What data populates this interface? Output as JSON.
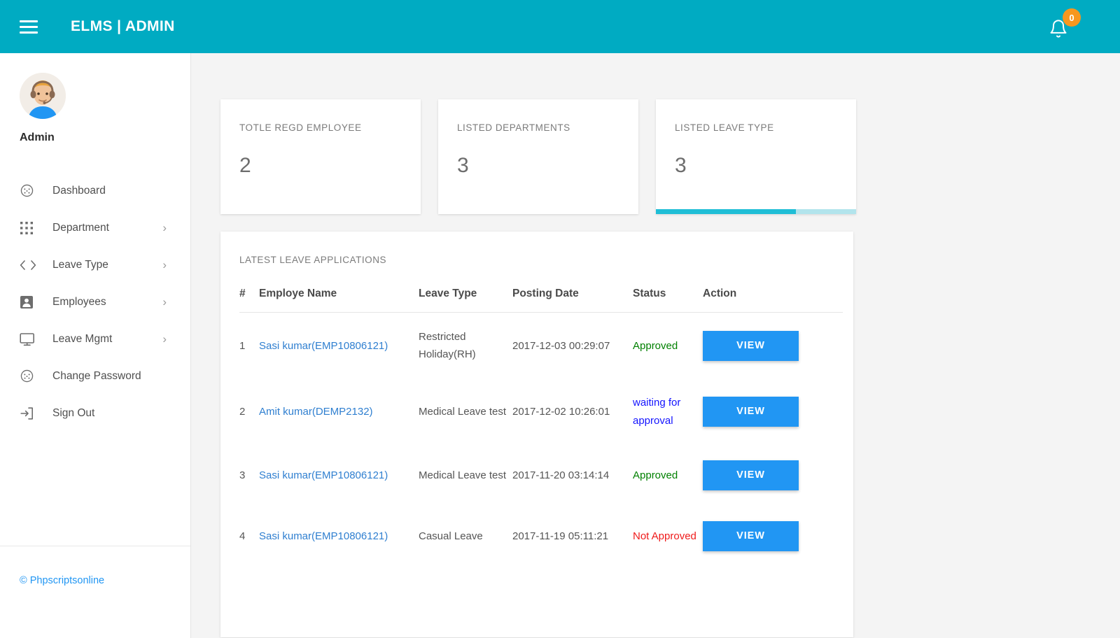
{
  "topbar": {
    "menu_icon": "hamburger-icon",
    "brand": "ELMS | ADMIN",
    "bell_icon": "bell-icon",
    "notification_count": "0",
    "background_color": "#00ABC2",
    "badge_color": "#F7971E"
  },
  "sidebar": {
    "avatar_icon": "admin-avatar-headset",
    "profile_name": "Admin",
    "items": [
      {
        "label": "Dashboard",
        "icon": "dashboard-icon",
        "has_submenu": false,
        "caret": ""
      },
      {
        "label": "Department",
        "icon": "grid-apps-icon",
        "has_submenu": true,
        "caret": "›"
      },
      {
        "label": "Leave Type",
        "icon": "code-brackets-icon",
        "has_submenu": true,
        "caret": "›"
      },
      {
        "label": "Employees",
        "icon": "user-badge-icon",
        "has_submenu": true,
        "caret": "›"
      },
      {
        "label": "Leave Mgmt",
        "icon": "monitor-icon",
        "has_submenu": true,
        "caret": "›"
      },
      {
        "label": "Change Password",
        "icon": "dashboard-icon",
        "has_submenu": false,
        "caret": ""
      },
      {
        "label": "Sign Out",
        "icon": "sign-out-icon",
        "has_submenu": false,
        "caret": ""
      }
    ],
    "footer": {
      "label": "© Phpscriptsonline",
      "color": "#2196F3"
    }
  },
  "main": {
    "stat_cards": [
      {
        "title": "TOTLE REGD EMPLOYEE",
        "value": "2",
        "progress_percent": 0
      },
      {
        "title": "LISTED DEPARTMENTS",
        "value": "3",
        "progress_percent": 0
      },
      {
        "title": "LISTED LEAVE TYPE",
        "value": "3",
        "progress_percent": 70
      }
    ],
    "table": {
      "title": "LATEST LEAVE APPLICATIONS",
      "columns": [
        "#",
        "Employe Name",
        "Leave Type",
        "Posting Date",
        "Status",
        "Action"
      ],
      "action_label": "VIEW",
      "rows": [
        {
          "num": "1",
          "employee": "Sasi kumar(EMP10806121)",
          "leave_type": "Restricted Holiday(RH)",
          "posting_date": "2017-12-03 00:29:07",
          "status": "Approved",
          "status_kind": "approved",
          "action": "VIEW"
        },
        {
          "num": "2",
          "employee": "Amit kumar(DEMP2132)",
          "leave_type": "Medical Leave test",
          "posting_date": "2017-12-02 10:26:01",
          "status": "waiting for approval",
          "status_kind": "waiting",
          "action": "VIEW"
        },
        {
          "num": "3",
          "employee": "Sasi kumar(EMP10806121)",
          "leave_type": "Medical Leave test",
          "posting_date": "2017-11-20 03:14:14",
          "status": "Approved",
          "status_kind": "approved",
          "action": "VIEW"
        },
        {
          "num": "4",
          "employee": "Sasi kumar(EMP10806121)",
          "leave_type": "Casual Leave",
          "posting_date": "2017-11-19 05:11:21",
          "status": "Not Approved",
          "status_kind": "not",
          "action": "VIEW"
        }
      ]
    }
  },
  "colors": {
    "accent_teal": "#00ABC2",
    "link_blue": "#2196F3",
    "status_approved": "#008000",
    "status_waiting": "#1414FF",
    "status_not_approved": "#EF1B1B",
    "page_background": "#F4F4F4"
  }
}
